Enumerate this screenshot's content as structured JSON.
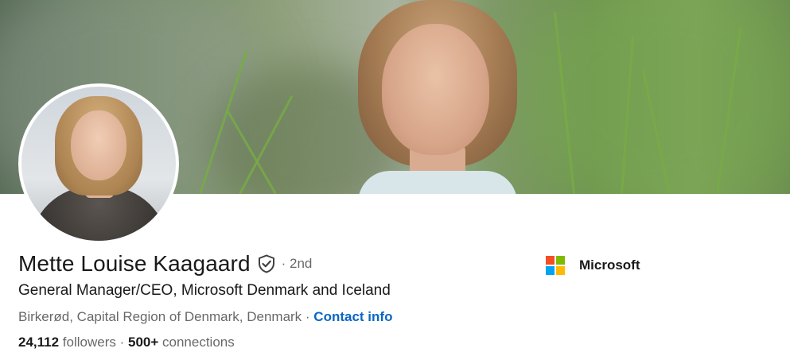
{
  "profile": {
    "name": "Mette Louise Kaagaard",
    "degree": "· 2nd",
    "headline": "General Manager/CEO, Microsoft Denmark and Iceland",
    "location": "Birkerød, Capital Region of Denmark, Denmark",
    "location_separator": " · ",
    "contact_info": "Contact info",
    "followers_count": "24,112",
    "followers_label": " followers",
    "stats_separator": " · ",
    "connections_count": "500+",
    "connections_label": " connections"
  },
  "company": {
    "name": "Microsoft",
    "logo_colors": [
      "#f25022",
      "#7fba00",
      "#00a4ef",
      "#ffb900"
    ]
  },
  "icons": {
    "verified": "shield-check-icon"
  },
  "colors": {
    "link": "#0a66c2"
  }
}
